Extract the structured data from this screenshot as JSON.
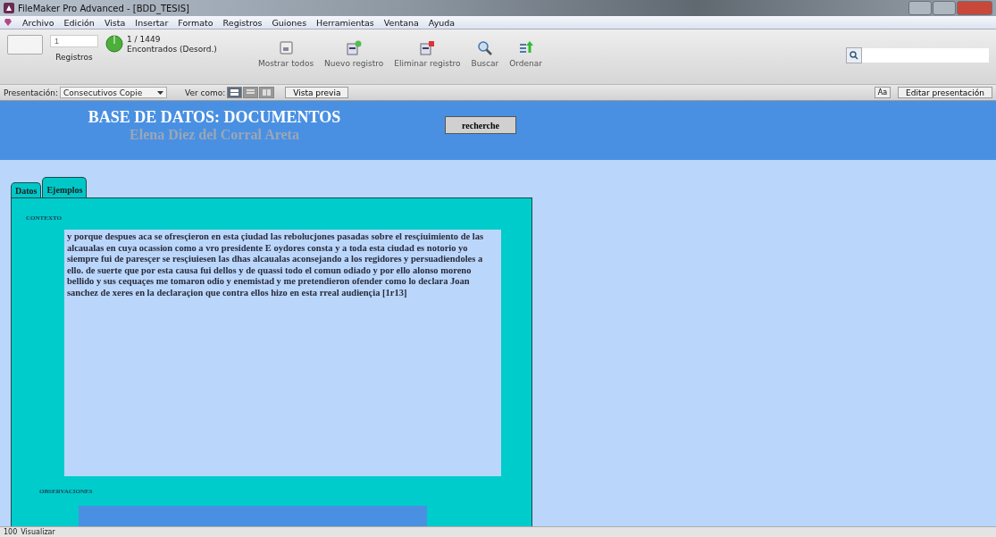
{
  "window": {
    "title": "FileMaker Pro Advanced - [BDD_TESIS]"
  },
  "menu": [
    "Archivo",
    "Edición",
    "Vista",
    "Insertar",
    "Formato",
    "Registros",
    "Guiones",
    "Herramientas",
    "Ventana",
    "Ayuda"
  ],
  "toolbar": {
    "record_number": "1",
    "records_label": "Registros",
    "count": "1 / 1449",
    "found": "Encontrados (Desord.)",
    "buttons": [
      {
        "kind": "show-all",
        "label": "Mostrar todos"
      },
      {
        "kind": "new",
        "label": "Nuevo registro"
      },
      {
        "kind": "delete",
        "label": "Eliminar registro"
      },
      {
        "kind": "search",
        "label": "Buscar"
      },
      {
        "kind": "sort",
        "label": "Ordenar"
      }
    ]
  },
  "layout_bar": {
    "layout_label": "Presentación:",
    "layout": "Consecutivos Copie",
    "view_label": "Ver como:",
    "views": [
      {
        "kind": "form",
        "selected": true
      },
      {
        "kind": "list",
        "selected": false
      },
      {
        "kind": "table",
        "selected": false
      }
    ],
    "preview": "Vista previa",
    "font_button": "Aa",
    "edit_layout": "Editar presentación"
  },
  "header": {
    "title": "BASE DE DATOS: DOCUMENTOS",
    "subtitle": "Elena Diez del Corral Areta",
    "button": "recherche"
  },
  "tabs": [
    {
      "label": "Datos",
      "selected": false
    },
    {
      "label": "Ejemplos",
      "selected": true
    }
  ],
  "fields": [
    {
      "label": "CONTEXTO",
      "value": "y porque despues aca se ofresçieron en esta çiudad las rebolucjones pasadas sobre el resçiuimiento de las alcaualas en cuya ocassion como a vro presidente E oydores consta y a toda esta ciudad es notorio yo siempre fui de paresçer se resçiuiesen las dhas alcaualas aconsejando a los regidores y persuadiendoles a ello. de suerte que por esta causa fui dellos y de quassi todo el comun odiado y por ello alonso moreno bellido y sus cequaçes me tomaron odio y enemistad y me pretendieron ofender como lo declara Joan sanchez de xeres en la declaraçion que contra ellos hizo en esta rreal audiençia [1r13]"
    },
    {
      "label": "OBSERVACIONES"
    }
  ],
  "status_bar": {
    "zoom": "100",
    "mode": "Visualizar"
  }
}
